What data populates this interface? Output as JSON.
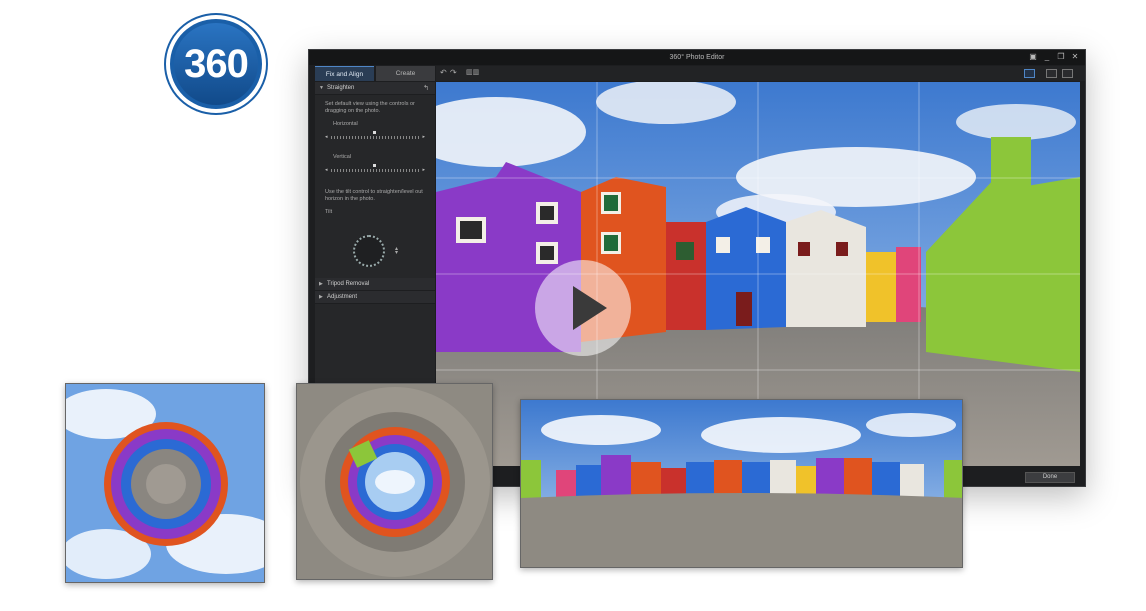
{
  "logo": {
    "text": "360"
  },
  "window": {
    "title": "360° Photo Editor",
    "tabs": [
      {
        "label": "Fix and Align",
        "active": true
      },
      {
        "label": "Create",
        "active": false
      }
    ],
    "panel": {
      "straighten": {
        "header": "Straighten",
        "instructions": "Set default view using the controls or dragging on the photo.",
        "horizontal_label": "Horizontal",
        "vertical_label": "Vertical",
        "tilt_instructions": "Use the tilt control to straighten/level out horizon in the photo.",
        "tilt_label": "Tilt"
      },
      "tripod_removal": {
        "header": "Tripod Removal"
      },
      "adjustment": {
        "header": "Adjustment"
      }
    },
    "done_label": "Done"
  },
  "colors": {
    "accent": "#4f86c6",
    "logo_blue": "#1a5fa8",
    "sky": "#5b8fd3",
    "house_purple": "#8a3ac7",
    "house_orange": "#e0541f",
    "house_blue": "#2b6ad4",
    "house_green": "#8cc63a",
    "pavement": "#8a8680"
  },
  "icons": [
    "undo-icon",
    "redo-icon",
    "filmstrip-icon",
    "grid-view-icon",
    "single-view-icon",
    "compare-view-icon",
    "minimize-icon",
    "restore-icon",
    "close-icon",
    "reset-icon",
    "play-icon"
  ]
}
